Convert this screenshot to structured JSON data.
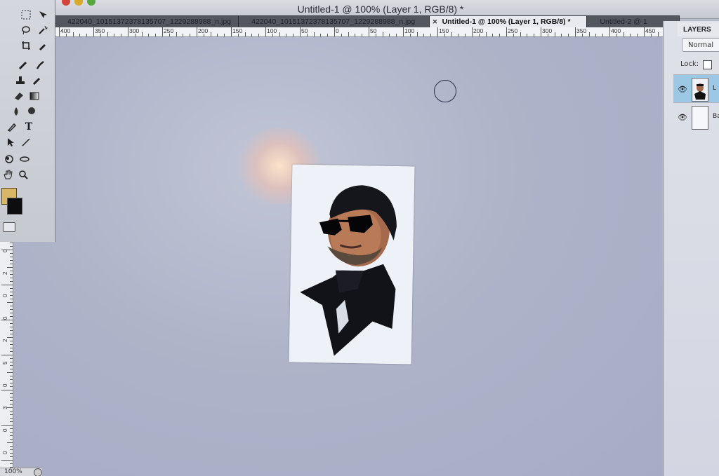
{
  "window": {
    "title": "Untitled-1 @ 100% (Layer 1, RGB/8) *"
  },
  "tabs": [
    {
      "label": "422040_10151372378135707_1229288988_n.jpg",
      "active": false
    },
    {
      "label": "422040_10151372378135707_1229288988_n.jpg",
      "active": false
    },
    {
      "label": "Untitled-1 @ 100% (Layer 1, RGB/8) *",
      "active": true
    },
    {
      "label": "Untitled-2 @ 1",
      "active": false
    }
  ],
  "ruler_top_labels": [
    "400",
    "350",
    "300",
    "250",
    "200",
    "150",
    "100",
    "50",
    "0",
    "50",
    "100",
    "150",
    "200",
    "250",
    "300",
    "350",
    "400",
    "450"
  ],
  "ruler_left_labels": [
    "1",
    "5",
    "0",
    "5",
    "1",
    "0",
    "0",
    "1",
    "5",
    "0",
    "2",
    "0",
    "0",
    "2",
    "5",
    "0",
    "3",
    "0",
    "0"
  ],
  "tools": {
    "icons": [
      "marquee-icon",
      "move-icon",
      "lasso-icon",
      "magic-wand-icon",
      "crop-icon",
      "eyedropper-icon",
      "healing-brush-icon",
      "brush-icon",
      "clone-stamp-icon",
      "history-brush-icon",
      "eraser-icon",
      "gradient-icon",
      "blur-icon",
      "dodge-icon",
      "pen-icon",
      "type-icon",
      "path-selection-icon",
      "shape-line-icon",
      "3d-rotate-icon",
      "3d-orbit-icon",
      "hand-icon",
      "zoom-icon"
    ],
    "type_glyph": "T",
    "foreground_color": "#d8b866",
    "background_color": "#0d0d0f"
  },
  "layers_panel": {
    "title": "LAYERS",
    "blend_mode": "Normal",
    "lock_label": "Lock:",
    "layers": [
      {
        "name": "L",
        "selected": true
      },
      {
        "name": "Ba",
        "selected": false
      }
    ]
  },
  "status": {
    "zoom": "100%"
  },
  "colors": {
    "selected_layer": "#9cc8e6",
    "canvas": "#afb3c8",
    "tab_active": "#e9eaf0"
  }
}
